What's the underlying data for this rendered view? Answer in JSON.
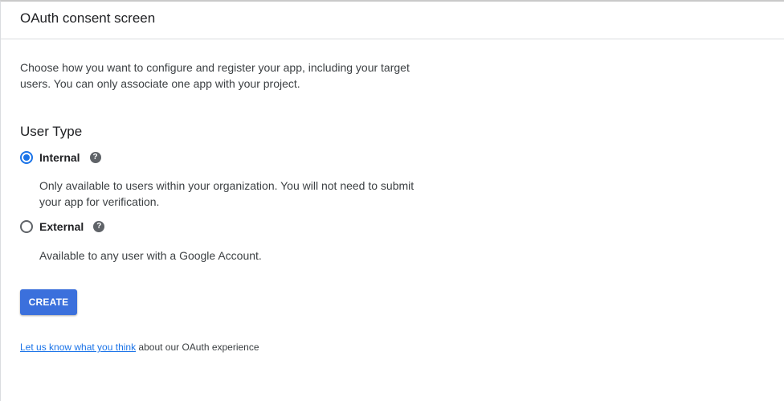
{
  "header": {
    "title": "OAuth consent screen"
  },
  "intro": {
    "text": "Choose how you want to configure and register your app, including your target users. You can only associate one app with your project."
  },
  "user_type": {
    "title": "User Type",
    "options": [
      {
        "label": "Internal",
        "selected": true,
        "help_icon": "help-circle-icon",
        "description": "Only available to users within your organization. You will not need to submit your app for verification."
      },
      {
        "label": "External",
        "selected": false,
        "help_icon": "help-circle-icon",
        "description": "Available to any user with a Google Account."
      }
    ]
  },
  "actions": {
    "create_label": "CREATE"
  },
  "feedback": {
    "link_text": "Let us know what you think",
    "suffix": " about our OAuth experience"
  },
  "colors": {
    "primary_button": "#3b70dc",
    "radio_selected": "#1a73e8",
    "link": "#1a73e8",
    "help_icon": "#5f6368"
  }
}
